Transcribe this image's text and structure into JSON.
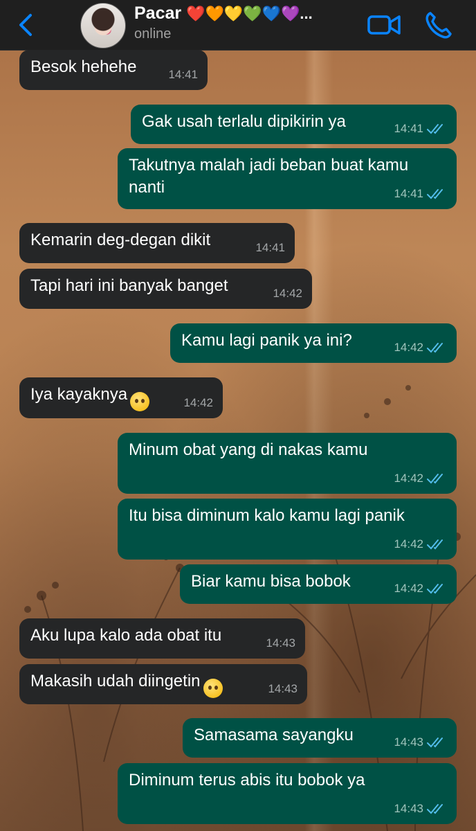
{
  "header": {
    "contact_name": "Pacar",
    "hearts": "❤️🧡💛💚💙💜...",
    "status": "online",
    "accent_color": "#0a84ff"
  },
  "icons": {
    "back": "chevron-left-icon",
    "video": "video-camera-icon",
    "call": "phone-icon",
    "read": "double-check-icon"
  },
  "colors": {
    "incoming_bubble": "#252627",
    "outgoing_bubble": "#005145",
    "read_ticks": "#53bdeb"
  },
  "messages": [
    {
      "dir": "in",
      "text": "Besok hehehe",
      "time": "14:41"
    },
    {
      "dir": "out",
      "text": "Gak usah terlalu dipikirin ya",
      "time": "14:41",
      "read": true
    },
    {
      "dir": "out",
      "text": "Takutnya malah jadi beban buat kamu nanti",
      "time": "14:41",
      "read": true
    },
    {
      "dir": "in",
      "text": "Kemarin deg-degan dikit",
      "time": "14:41"
    },
    {
      "dir": "in",
      "text": "Tapi hari ini banyak banget",
      "time": "14:42"
    },
    {
      "dir": "out",
      "text": "Kamu lagi panik ya ini?",
      "time": "14:42",
      "read": true
    },
    {
      "dir": "in",
      "text": "Iya kayaknya",
      "emoji": "😮‍💨",
      "time": "14:42"
    },
    {
      "dir": "out",
      "text": "Minum obat yang di nakas kamu",
      "time": "14:42",
      "read": true
    },
    {
      "dir": "out",
      "text": "Itu bisa diminum kalo kamu lagi panik",
      "time": "14:42",
      "read": true
    },
    {
      "dir": "out",
      "text": "Biar kamu bisa bobok",
      "time": "14:42",
      "read": true
    },
    {
      "dir": "in",
      "text": "Aku lupa kalo ada obat itu",
      "time": "14:43"
    },
    {
      "dir": "in",
      "text": "Makasih udah diingetin",
      "emoji": "🥺",
      "time": "14:43"
    },
    {
      "dir": "out",
      "text": "Samasama sayangku",
      "time": "14:43",
      "read": true
    },
    {
      "dir": "out",
      "text": "Diminum terus abis itu bobok ya",
      "time": "14:43",
      "read": true
    }
  ]
}
